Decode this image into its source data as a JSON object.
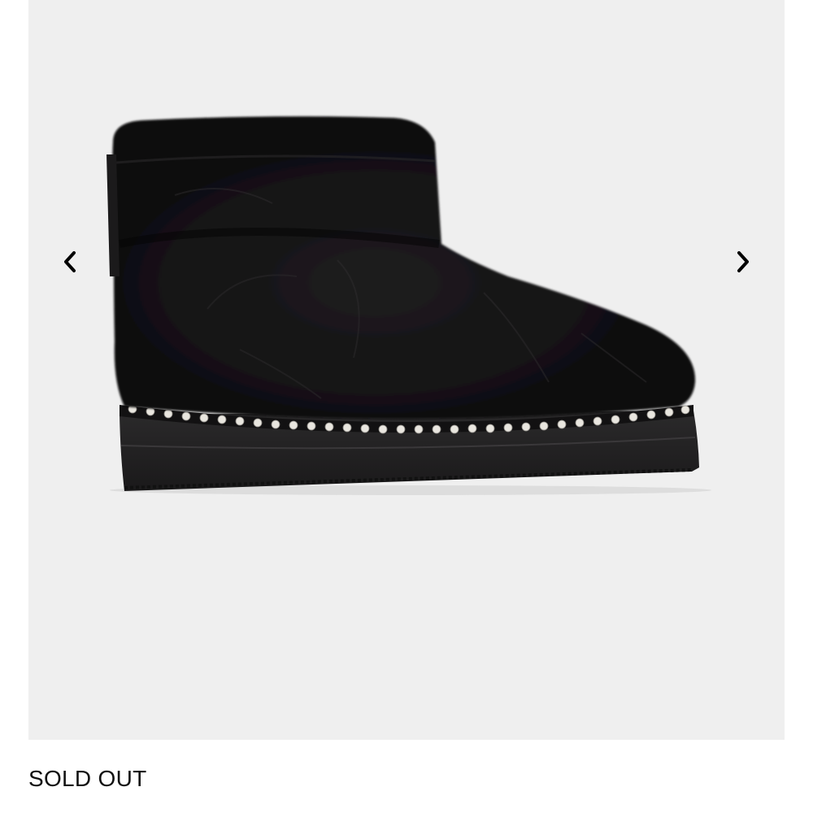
{
  "gallery": {
    "background_color": "#efefef",
    "prev_icon": "chevron-left-icon",
    "next_icon": "chevron-right-icon",
    "image_subject": "black-shearling-ankle-boot"
  },
  "product": {
    "status_label": "SOLD OUT"
  },
  "colors": {
    "boot": "#0d0c0d",
    "sole": "#232223",
    "studs": "#e9e6df",
    "text": "#111111"
  }
}
